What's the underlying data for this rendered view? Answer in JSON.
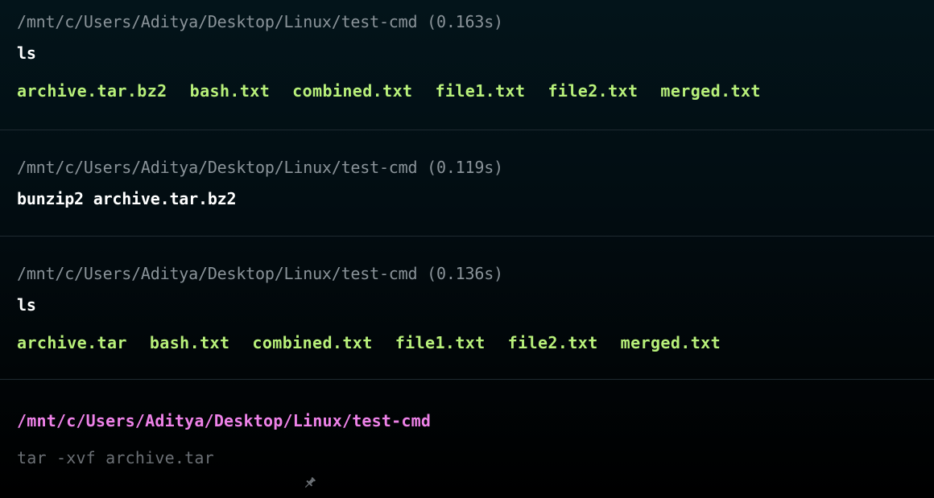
{
  "blocks": [
    {
      "path": "/mnt/c/Users/Aditya/Desktop/Linux/test-cmd (0.163s)",
      "command": "ls",
      "output": [
        "archive.tar.bz2",
        "bash.txt",
        "combined.txt",
        "file1.txt",
        "file2.txt",
        "merged.txt"
      ]
    },
    {
      "path": "/mnt/c/Users/Aditya/Desktop/Linux/test-cmd (0.119s)",
      "command": "bunzip2 archive.tar.bz2",
      "output": []
    },
    {
      "path": "/mnt/c/Users/Aditya/Desktop/Linux/test-cmd (0.136s)",
      "command": "ls",
      "output": [
        "archive.tar",
        "bash.txt",
        "combined.txt",
        "file1.txt",
        "file2.txt",
        "merged.txt"
      ]
    }
  ],
  "prompt": {
    "path": "/mnt/c/Users/Aditya/Desktop/Linux/test-cmd",
    "input_value": "tar -xvf archive.tar",
    "icon": "pin-icon"
  },
  "colors": {
    "output": "#b8f07a",
    "prompt_path": "#ee82e8",
    "path": "#8a9399"
  }
}
